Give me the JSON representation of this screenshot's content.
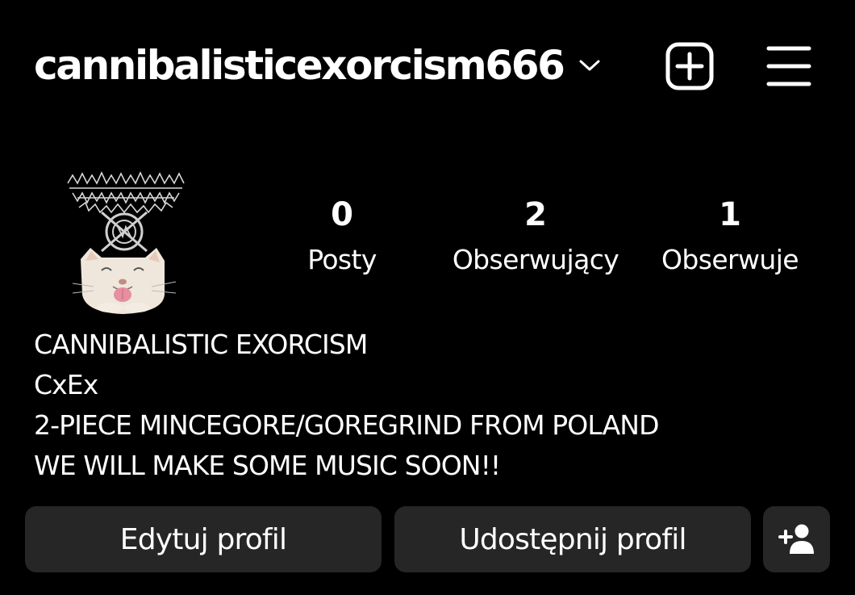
{
  "header": {
    "username": "cannibalisticexorcism666"
  },
  "avatar": {
    "logo_text": "CANNIBALISTIC EXORCISM"
  },
  "stats": {
    "posts": {
      "value": "0",
      "label": "Posty"
    },
    "followers": {
      "value": "2",
      "label": "Obserwujący"
    },
    "following": {
      "value": "1",
      "label": "Obserwuje"
    }
  },
  "bio": {
    "lines": [
      "CANNIBALISTIC EXORCISM",
      "CxEx",
      "2-PIECE MINCEGORE/GOREGRIND FROM POLAND",
      "WE WILL MAKE SOME MUSIC SOON!!"
    ]
  },
  "actions": {
    "edit_profile": "Edytuj profil",
    "share_profile": "Udostępnij profil"
  },
  "icons": {
    "dropdown": "chevron-down-icon",
    "create": "plus-square-icon",
    "menu": "hamburger-menu-icon",
    "add_user": "add-person-icon"
  },
  "colors": {
    "background": "#000000",
    "text": "#ffffff",
    "button_bg": "#262626"
  }
}
